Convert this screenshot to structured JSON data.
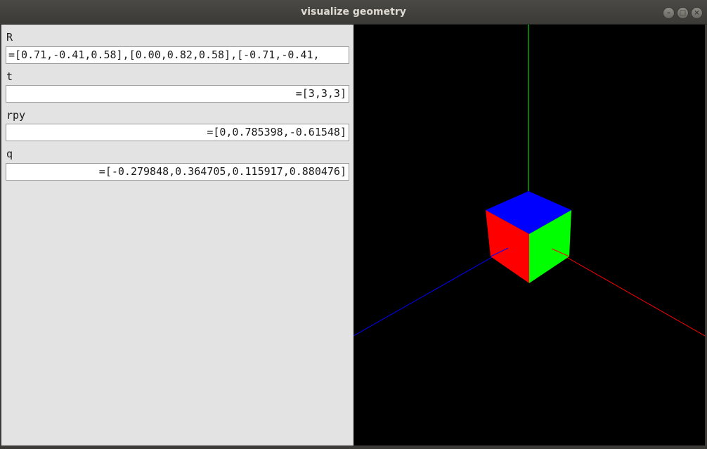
{
  "window": {
    "title": "visualize geometry"
  },
  "fields": {
    "R": {
      "label": "R",
      "value": "=[0.71,-0.41,0.58],[0.00,0.82,0.58],[-0.71,-0.41,"
    },
    "t": {
      "label": "t",
      "value": "=[3,3,3]"
    },
    "rpy": {
      "label": "rpy",
      "value": "=[0,0.785398,-0.61548]"
    },
    "q": {
      "label": "q",
      "value": "=[-0.279848,0.364705,0.115917,0.880476]"
    }
  },
  "viewport": {
    "background_color": "#000000",
    "axis_colors": {
      "x": "#ff0000",
      "y": "#00ff00",
      "z": "#0000ff"
    },
    "cube_face_colors": {
      "top": "#0000ff",
      "left": "#ff0000",
      "right": "#00ff00"
    }
  }
}
